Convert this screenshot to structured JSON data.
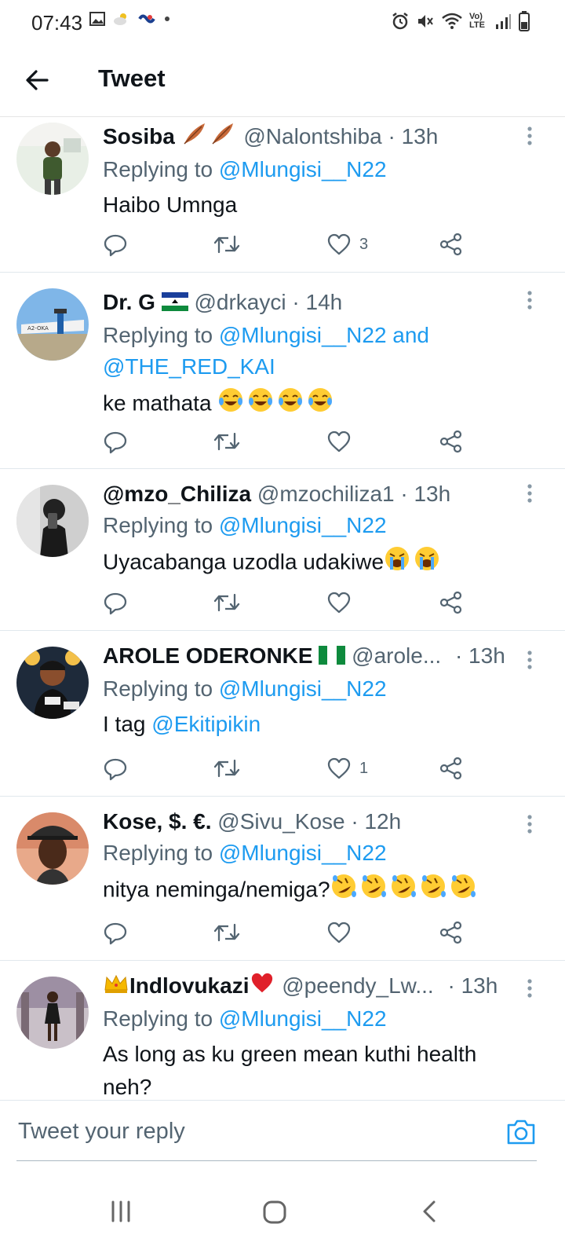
{
  "status_bar": {
    "time": "07:43",
    "left_icons": [
      "gallery-icon",
      "weather-icon",
      "app-icon",
      "dot-icon"
    ],
    "right_icons": [
      "alarm-icon",
      "mute-icon",
      "wifi-icon",
      "volte-icon",
      "signal-icon",
      "battery-icon"
    ],
    "volte_label": "Vo) LTE"
  },
  "header": {
    "title": "Tweet"
  },
  "tweets": [
    {
      "name": "Sosiba",
      "name_suffix_icon": "feather-icon",
      "handle": "@Nalontshiba",
      "time": "· 13h",
      "replying_prefix": "Replying to",
      "replying_to": "@Mlungisi__N22",
      "replying_to_2": "",
      "text": "Haibo Umnga",
      "text_mention": "",
      "likes": "3"
    },
    {
      "name": "Dr. G",
      "name_suffix_icon": "lesotho-flag-icon",
      "handle": "@drkayci",
      "time": "· 14h",
      "replying_prefix": "Replying to",
      "replying_to": "@Mlungisi__N22 and",
      "replying_to_2": "@THE_RED_KAI",
      "text": "ke mathata",
      "text_mention": "",
      "likes": ""
    },
    {
      "name": "@mzo_Chiliza",
      "name_suffix_icon": "",
      "handle": "@mzochiliza1",
      "time": "· 13h",
      "replying_prefix": "Replying to",
      "replying_to": "@Mlungisi__N22",
      "replying_to_2": "",
      "text": "Uyacabanga uzodla udakiwe",
      "text_mention": "",
      "likes": ""
    },
    {
      "name": "AROLE ODERONKE",
      "name_suffix_icon": "nigeria-flag-icon",
      "handle": "@arole...",
      "time": "· 13h",
      "replying_prefix": "Replying to",
      "replying_to": "@Mlungisi__N22",
      "replying_to_2": "",
      "text": "I tag",
      "text_mention": "@Ekitipikin",
      "likes": "1"
    },
    {
      "name": "Kose, $. €.",
      "name_suffix_icon": "",
      "handle": "@Sivu_Kose",
      "time": "· 12h",
      "replying_prefix": "Replying to",
      "replying_to": "@Mlungisi__N22",
      "replying_to_2": "",
      "text": "nitya neminga/nemiga?",
      "text_mention": "",
      "likes": ""
    },
    {
      "name": "Indlovukazi",
      "name_suffix_icon": "heart-emoji-icon",
      "handle": "@peendy_Lw...",
      "time": "· 13h",
      "replying_prefix": "Replying to",
      "replying_to": "@Mlungisi__N22",
      "replying_to_2": "",
      "text": "As long as ku green mean kuthi health",
      "text_line2": "neh?",
      "text_mention": "",
      "likes": ""
    }
  ],
  "reply_bar": {
    "placeholder": "Tweet your reply"
  },
  "colors": {
    "link": "#1d9bf0",
    "secondary_text": "#536471",
    "primary_text": "#0f1419"
  }
}
